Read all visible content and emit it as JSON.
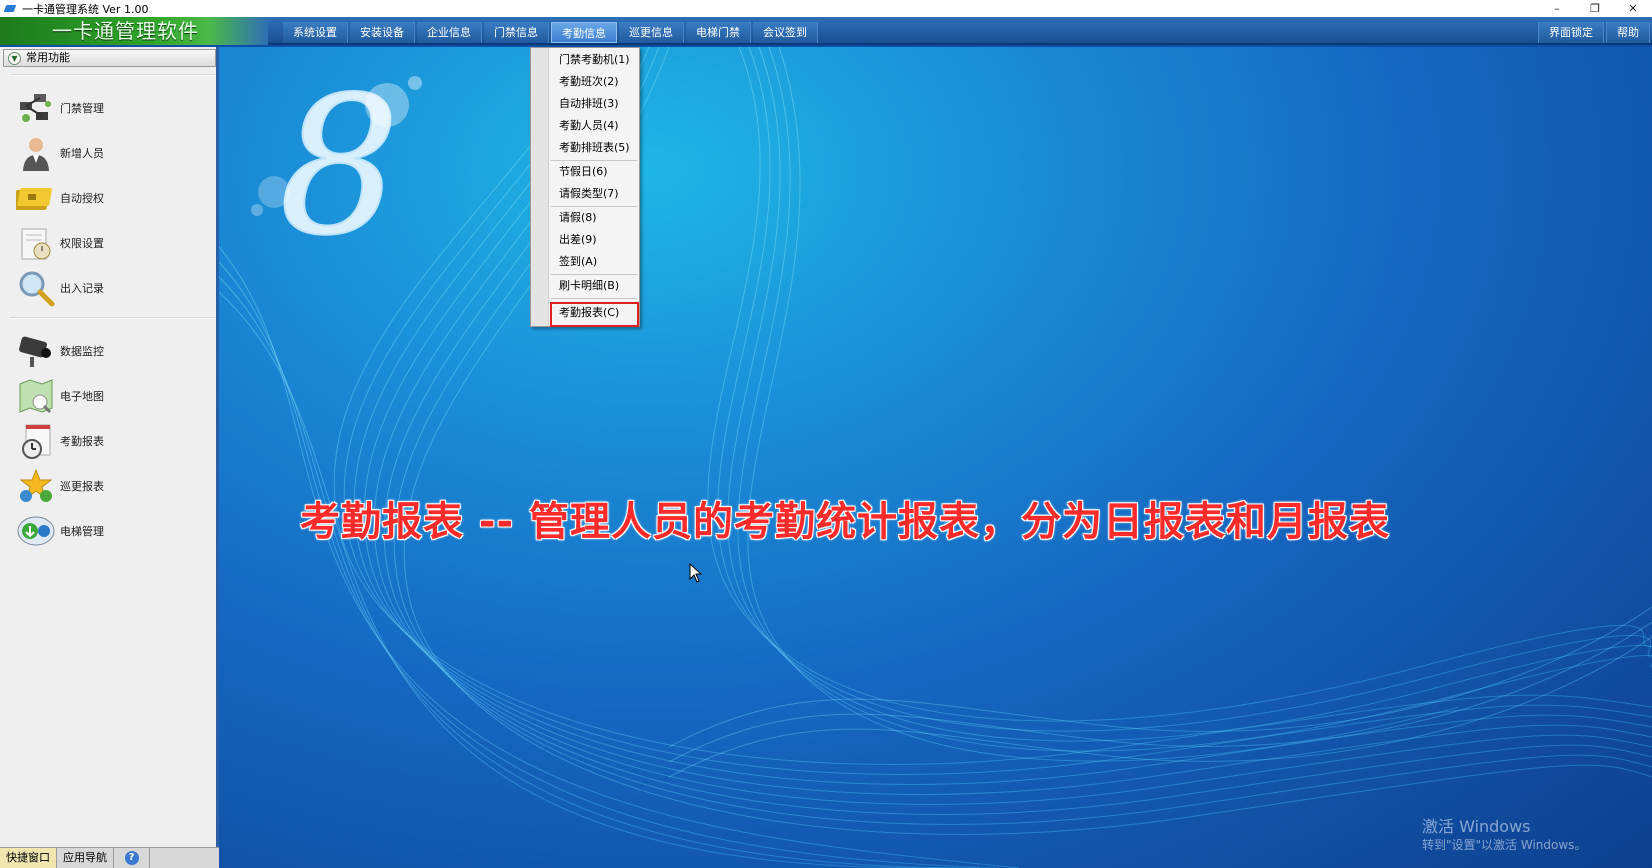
{
  "window": {
    "title": "一卡通管理系统  Ver 1.00",
    "controls": {
      "minimize": "–",
      "restore": "❐",
      "close": "✕"
    }
  },
  "brand": "一卡通管理软件",
  "menu": {
    "items": [
      "系统设置",
      "安装设备",
      "企业信息",
      "门禁信息",
      "考勤信息",
      "巡更信息",
      "电梯门禁",
      "会议签到"
    ],
    "active_index": 4,
    "right_items": [
      "界面锁定",
      "帮助"
    ]
  },
  "sidebar": {
    "header": "常用功能",
    "group1": [
      "门禁管理",
      "新增人员",
      "自动授权",
      "权限设置",
      "出入记录"
    ],
    "group2": [
      "数据监控",
      "电子地图",
      "考勤报表",
      "巡更报表",
      "电梯管理"
    ]
  },
  "bottom_tabs": {
    "quick": "快捷窗口",
    "nav": "应用导航",
    "help_glyph": "?"
  },
  "dropdown": {
    "items": [
      "门禁考勤机(1)",
      "考勤班次(2)",
      "自动排班(3)",
      "考勤人员(4)",
      "考勤排班表(5)",
      "节假日(6)",
      "请假类型(7)",
      "请假(8)",
      "出差(9)",
      "签到(A)",
      "刷卡明细(B)",
      "考勤报表(C)"
    ],
    "highlighted": "考勤报表(C)"
  },
  "caption": "考勤报表 -- 管理人员的考勤统计报表，分为日报表和月报表",
  "watermark": {
    "line1": "激活 Windows",
    "line2": "转到\"设置\"以激活 Windows。"
  },
  "colors": {
    "caption": "#ff2a2a",
    "highlight_border": "#e02020",
    "brand_green": "#2fa32a",
    "menubar_blue": "#1a4f94"
  }
}
